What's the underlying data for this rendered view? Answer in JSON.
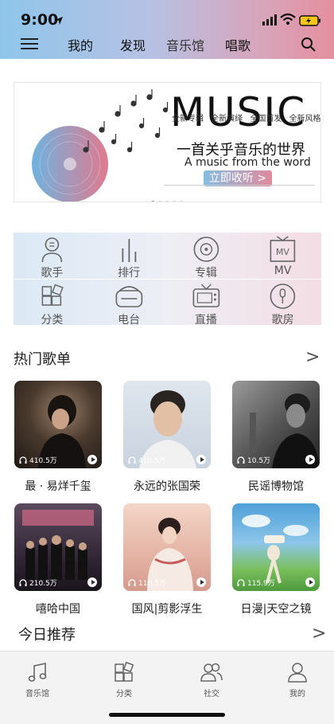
{
  "status": {
    "time": "9:00"
  },
  "nav": {
    "tabs": [
      {
        "label": "我的"
      },
      {
        "label": "发现"
      },
      {
        "label": "音乐馆"
      },
      {
        "label": "唱歌"
      }
    ]
  },
  "banner": {
    "title": "MUSIC",
    "tags": [
      "全新专辑",
      "全新演绎",
      "全国首发",
      "全新风格"
    ],
    "subtitle": "一首关乎音乐的世界",
    "subtitle_en": "A music from the word",
    "cta": "立即收听 >",
    "dots": 5,
    "active_dot": 0
  },
  "categories": [
    {
      "label": "歌手",
      "icon": "singer-icon"
    },
    {
      "label": "排行",
      "icon": "ranking-icon"
    },
    {
      "label": "专辑",
      "icon": "album-icon"
    },
    {
      "label": "MV",
      "icon": "mv-icon"
    },
    {
      "label": "分类",
      "icon": "category-icon"
    },
    {
      "label": "电台",
      "icon": "radio-icon"
    },
    {
      "label": "直播",
      "icon": "live-tv-icon"
    },
    {
      "label": "歌房",
      "icon": "karaoke-mic-icon"
    }
  ],
  "hot_playlists": {
    "title": "热门歌单",
    "more": ">",
    "items": [
      {
        "title": "最 · 易烊千玺",
        "plays": "410.5万",
        "accent": "#2b2622"
      },
      {
        "title": "永远的张国荣",
        "plays": "410.5万",
        "accent": "#c9d3e0"
      },
      {
        "title": "民谣博物馆",
        "plays": "10.5万",
        "accent": "#3a3a3a"
      },
      {
        "title": "嘻哈中国",
        "plays": "210.5万",
        "accent": "#3b2f3e"
      },
      {
        "title": "国风|剪影浮生",
        "plays": "110.5万",
        "accent": "#e7b9a8"
      },
      {
        "title": "日漫|天空之镜",
        "plays": "115.9万",
        "accent": "#5aa8d8"
      }
    ]
  },
  "today": {
    "title": "今日推荐",
    "more": ">"
  },
  "tabbar": {
    "items": [
      {
        "label": "音乐馆",
        "icon": "music-note-icon"
      },
      {
        "label": "分类",
        "icon": "category-icon"
      },
      {
        "label": "社交",
        "icon": "social-icon"
      },
      {
        "label": "我的",
        "icon": "profile-icon"
      }
    ]
  }
}
